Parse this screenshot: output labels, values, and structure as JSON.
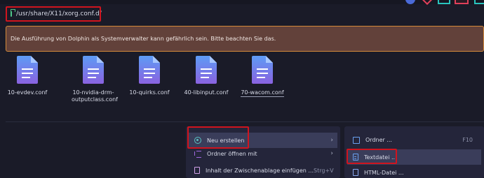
{
  "window_controls": [
    "button-a",
    "button-b",
    "button-c",
    "button-d",
    "button-e"
  ],
  "location": {
    "path": "/usr/share/X11/xorg.conf.d/",
    "icon": "folder-icon"
  },
  "warning": {
    "text": "Die Ausführung von Dolphin als Systemverwalter kann gefährlich sein. Bitte beachten Sie das."
  },
  "files": [
    {
      "name": "10-evdev.conf"
    },
    {
      "name": "10-nvidia-drm-outputclass.conf"
    },
    {
      "name": "10-quirks.conf"
    },
    {
      "name": "40-libinput.conf"
    },
    {
      "name": "70-wacom.conf"
    }
  ],
  "context_menu": {
    "items": [
      {
        "label": "Neu erstellen",
        "icon": "new-icon",
        "submenu": true
      },
      {
        "label": "Ordner öffnen mit",
        "icon": "open-with-icon",
        "submenu": true
      },
      {
        "label": "Inhalt der Zwischenablage einfügen ...",
        "icon": "clipboard-icon",
        "shortcut": "Strg+V"
      }
    ]
  },
  "submenu": {
    "items": [
      {
        "label": "Ordner ...",
        "icon": "folder-icon",
        "shortcut": "F10"
      },
      {
        "label": "Textdatei ...",
        "icon": "text-file-icon"
      },
      {
        "label": "HTML-Datei ...",
        "icon": "html-file-icon"
      }
    ]
  },
  "colors": {
    "background": "#1a1b28",
    "warning_bg": "#62413a",
    "warning_border": "#d48a3a",
    "menu_bg": "#24253a",
    "highlight": "#d0141e",
    "file_icon_top": "#5d9cf5",
    "file_icon_bottom": "#8a62e0"
  }
}
